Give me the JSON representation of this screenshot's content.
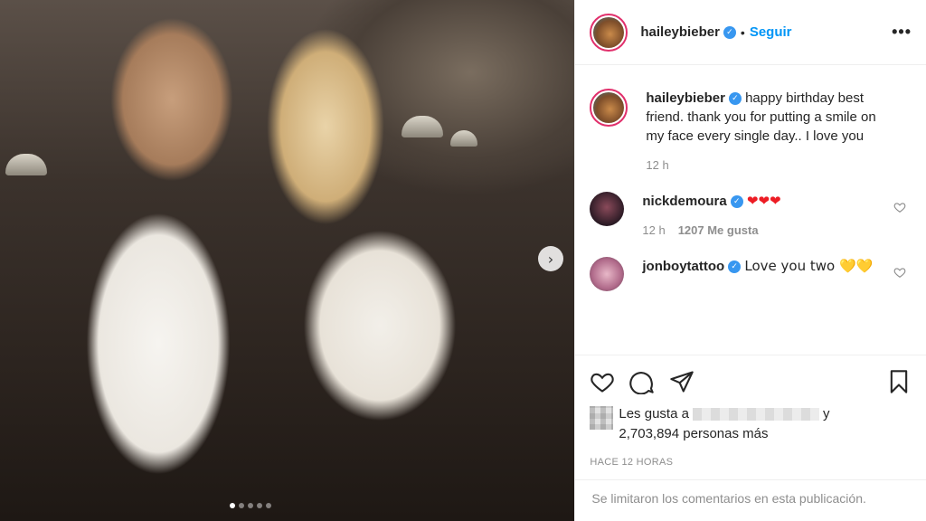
{
  "post": {
    "carousel": {
      "slide_count": 5,
      "active_index": 0,
      "next_arrow": "›"
    }
  },
  "header": {
    "username": "haileybieber",
    "separator": "•",
    "follow_label": "Seguir",
    "more_label": "•••"
  },
  "caption": {
    "username": "haileybieber",
    "text": "happy birthday best friend. thank you for putting a smile on my face every single day.. I love you",
    "time": "12 h"
  },
  "comments": [
    {
      "username": "nickdemoura",
      "text": "❤❤❤",
      "time": "12 h",
      "likes": "1207 Me gusta"
    },
    {
      "username": "jonboytattoo",
      "text": "Love you two 💛💛"
    }
  ],
  "likes": {
    "prefix": "Les gusta a",
    "suffix": "y",
    "count_line": "2,703,894 personas más"
  },
  "timestamp": "HACE 12 HORAS",
  "comments_limited": "Se limitaron los comentarios en esta publicación.",
  "icons": {
    "verified": "verified-badge-icon",
    "like": "heart-icon",
    "comment": "comment-bubble-icon",
    "share": "paper-plane-icon",
    "save": "bookmark-icon"
  },
  "colors": {
    "accent": "#0095f6",
    "verified": "#3897f0",
    "heart": "#ed1c24",
    "yellow_heart": "#f5c518"
  }
}
